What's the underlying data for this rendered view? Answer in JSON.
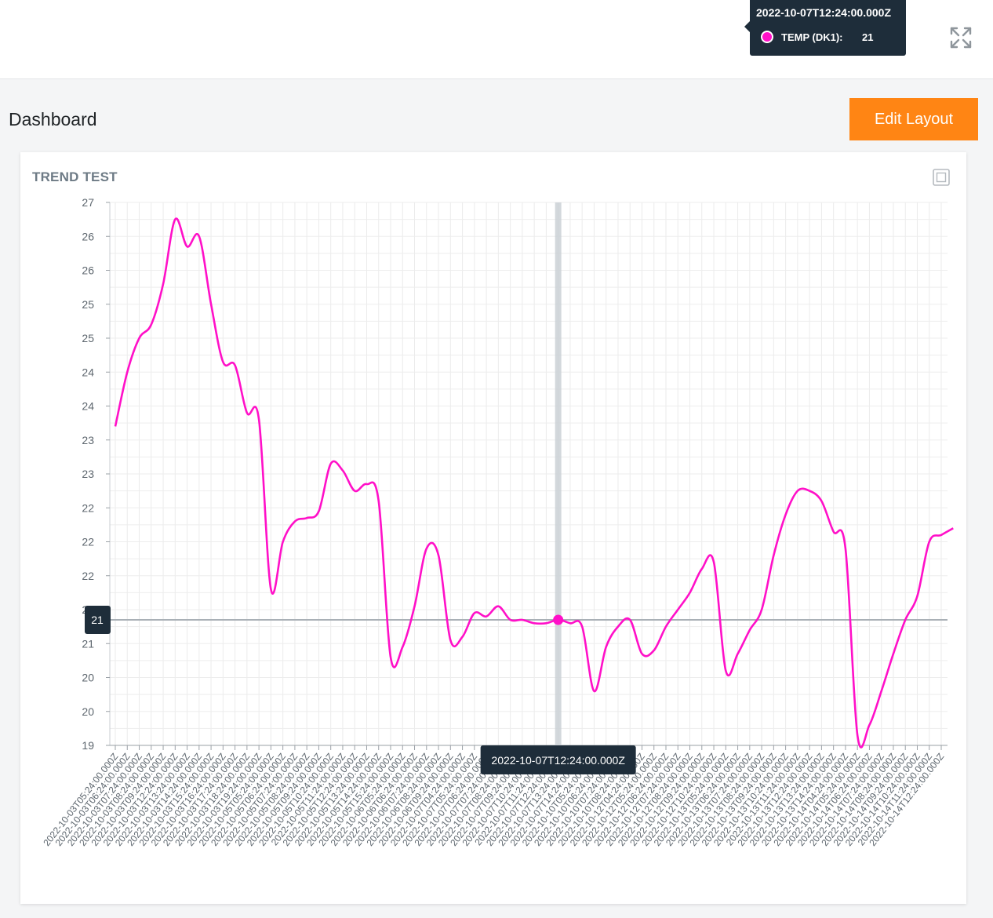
{
  "header": {
    "tooltip": {
      "time": "2022-10-07T12:24:00.000Z",
      "series": "TEMP (DK1):",
      "value": "21",
      "series_color": "#ff10c8"
    },
    "expand_icon": "expand-arrows-icon"
  },
  "page": {
    "title": "Dashboard",
    "edit_label": "Edit Layout",
    "accent_color": "#ff8514"
  },
  "card": {
    "title": "TREND TEST",
    "maximize_icon": "maximize-icon"
  },
  "chart_data": {
    "type": "line",
    "title": "TREND TEST",
    "series_name": "TEMP (DK1)",
    "line_color": "#ff10c8",
    "grid": true,
    "ylim": [
      19,
      27
    ],
    "y_tick_values": [
      19,
      19.5,
      20,
      20.5,
      21,
      21.5,
      22,
      22.5,
      23,
      23.5,
      24,
      24.5,
      25,
      25.5,
      26,
      26.5,
      27
    ],
    "y_tick_labels": [
      "19",
      "20",
      "20",
      "21",
      "21",
      "22",
      "22",
      "22",
      "23",
      "23",
      "24",
      "24",
      "25",
      "25",
      "26",
      "26",
      "27"
    ],
    "x_labels": [
      "2022-10-03T05:24:00.000Z",
      "2022-10-03T06:24:00.000Z",
      "2022-10-03T07:24:00.000Z",
      "2022-10-03T08:24:00.000Z",
      "2022-10-03T09:24:00.000Z",
      "2022-10-03T12:24:00.000Z",
      "2022-10-03T13:24:00.000Z",
      "2022-10-03T14:24:00.000Z",
      "2022-10-03T15:24:00.000Z",
      "2022-10-03T16:24:00.000Z",
      "2022-10-03T17:24:00.000Z",
      "2022-10-03T18:24:00.000Z",
      "2022-10-03T19:24:00.000Z",
      "2022-10-05T05:24:00.000Z",
      "2022-10-05T06:24:00.000Z",
      "2022-10-05T07:24:00.000Z",
      "2022-10-05T08:24:00.000Z",
      "2022-10-05T09:24:00.000Z",
      "2022-10-05T10:24:00.000Z",
      "2022-10-05T11:24:00.000Z",
      "2022-10-05T12:24:00.000Z",
      "2022-10-05T13:24:00.000Z",
      "2022-10-05T14:24:00.000Z",
      "2022-10-05T15:24:00.000Z",
      "2022-10-06T05:24:00.000Z",
      "2022-10-06T06:24:00.000Z",
      "2022-10-06T07:24:00.000Z",
      "2022-10-06T08:24:00.000Z",
      "2022-10-06T09:24:00.000Z",
      "2022-10-07T04:24:00.000Z",
      "2022-10-07T05:24:00.000Z",
      "2022-10-07T06:24:00.000Z",
      "2022-10-07T07:24:00.000Z",
      "2022-10-07T08:24:00.000Z",
      "2022-10-07T09:24:00.000Z",
      "2022-10-07T10:24:00.000Z",
      "2022-10-07T11:24:00.000Z",
      "2022-10-07T12:24:00.000Z",
      "2022-10-07T13:24:00.000Z",
      "2022-10-07T14:24:00.000Z",
      "2022-10-10T05:24:00.000Z",
      "2022-10-10T06:24:00.000Z",
      "2022-10-10T07:24:00.000Z",
      "2022-10-10T08:24:00.000Z",
      "2022-10-12T04:24:00.000Z",
      "2022-10-12T05:24:00.000Z",
      "2022-10-12T06:24:00.000Z",
      "2022-10-12T07:24:00.000Z",
      "2022-10-12T08:24:00.000Z",
      "2022-10-12T09:24:00.000Z",
      "2022-10-12T10:24:00.000Z",
      "2022-10-13T05:24:00.000Z",
      "2022-10-13T06:24:00.000Z",
      "2022-10-13T07:24:00.000Z",
      "2022-10-13T08:24:00.000Z",
      "2022-10-13T09:24:00.000Z",
      "2022-10-13T10:24:00.000Z",
      "2022-10-13T11:24:00.000Z",
      "2022-10-13T12:24:00.000Z",
      "2022-10-13T13:24:00.000Z",
      "2022-10-13T14:24:00.000Z",
      "2022-10-14T04:24:00.000Z",
      "2022-10-14T05:24:00.000Z",
      "2022-10-14T06:24:00.000Z",
      "2022-10-14T07:24:00.000Z",
      "2022-10-14T08:24:00.000Z",
      "2022-10-14T09:24:00.000Z",
      "2022-10-14T10:24:00.000Z",
      "2022-10-14T11:24:00.000Z",
      "2022-10-14T12:24:00.000Z"
    ],
    "y": [
      23.7,
      24.5,
      25.0,
      25.2,
      25.8,
      26.75,
      26.35,
      26.5,
      25.5,
      24.65,
      24.6,
      23.9,
      23.8,
      21.3,
      22.0,
      22.3,
      22.35,
      22.45,
      23.15,
      23.05,
      22.75,
      22.85,
      22.6,
      20.3,
      20.45,
      21.05,
      21.9,
      21.8,
      20.55,
      20.6,
      20.95,
      20.9,
      21.05,
      20.85,
      20.85,
      20.8,
      20.8,
      20.85,
      20.8,
      20.75,
      19.8,
      20.45,
      20.75,
      20.85,
      20.35,
      20.4,
      20.75,
      21.0,
      21.25,
      21.6,
      21.7,
      20.1,
      20.35,
      20.7,
      21.0,
      21.8,
      22.4,
      22.75,
      22.75,
      22.6,
      22.15,
      21.9,
      19.15,
      19.3,
      19.8,
      20.35,
      20.85,
      21.2,
      22.0,
      22.1,
      22.2
    ],
    "crosshair": {
      "x": "2022-10-07T12:24:00.000Z",
      "y_label": "21",
      "y_value": 20.85
    }
  }
}
